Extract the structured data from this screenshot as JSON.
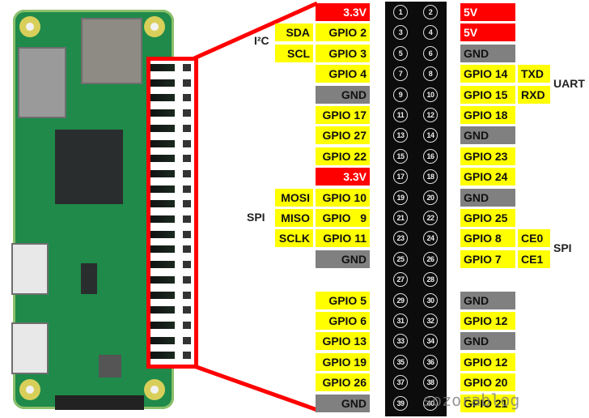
{
  "colors": {
    "power": "#ff0000",
    "gpio": "#ffff00",
    "ground": "#808080",
    "header": "#0c0c0c",
    "highlight": "#ff0000"
  },
  "rows": [
    {
      "l": "3.3V",
      "lt": "r",
      "lf": "",
      "p1": "1",
      "p2": "2",
      "r": "5V",
      "rt": "r",
      "rf": ""
    },
    {
      "l": "GPIO 2",
      "lt": "y",
      "lf": "SDA",
      "p1": "3",
      "p2": "4",
      "r": "5V",
      "rt": "r",
      "rf": ""
    },
    {
      "l": "GPIO 3",
      "lt": "y",
      "lf": "SCL",
      "p1": "5",
      "p2": "6",
      "r": "GND",
      "rt": "g",
      "rf": ""
    },
    {
      "l": "GPIO 4",
      "lt": "y",
      "lf": "",
      "p1": "7",
      "p2": "8",
      "r": "GPIO 14",
      "rt": "y",
      "rf": "TXD"
    },
    {
      "l": "GND",
      "lt": "g",
      "lf": "",
      "p1": "9",
      "p2": "10",
      "r": "GPIO 15",
      "rt": "y",
      "rf": "RXD"
    },
    {
      "l": "GPIO 17",
      "lt": "y",
      "lf": "",
      "p1": "11",
      "p2": "12",
      "r": "GPIO 18",
      "rt": "y",
      "rf": ""
    },
    {
      "l": "GPIO 27",
      "lt": "y",
      "lf": "",
      "p1": "13",
      "p2": "14",
      "r": "GND",
      "rt": "g",
      "rf": ""
    },
    {
      "l": "GPIO 22",
      "lt": "y",
      "lf": "",
      "p1": "15",
      "p2": "16",
      "r": "GPIO 23",
      "rt": "y",
      "rf": ""
    },
    {
      "l": "3.3V",
      "lt": "r",
      "lf": "",
      "p1": "17",
      "p2": "18",
      "r": "GPIO 24",
      "rt": "y",
      "rf": ""
    },
    {
      "l": "GPIO 10",
      "lt": "y",
      "lf": "MOSI",
      "p1": "19",
      "p2": "20",
      "r": "GND",
      "rt": "g",
      "rf": ""
    },
    {
      "l": "GPIO   9",
      "lt": "y",
      "lf": "MISO",
      "p1": "21",
      "p2": "22",
      "r": "GPIO 25",
      "rt": "y",
      "rf": ""
    },
    {
      "l": "GPIO 11",
      "lt": "y",
      "lf": "SCLK",
      "p1": "23",
      "p2": "24",
      "r": "GPIO 8",
      "rt": "y",
      "rf": "CE0"
    },
    {
      "l": "GND",
      "lt": "g",
      "lf": "",
      "p1": "25",
      "p2": "26",
      "r": "GPIO 7",
      "rt": "y",
      "rf": "CE1"
    },
    {
      "l": "",
      "lt": "",
      "lf": "",
      "p1": "27",
      "p2": "28",
      "r": "",
      "rt": "",
      "rf": ""
    },
    {
      "l": "GPIO 5",
      "lt": "y",
      "lf": "",
      "p1": "29",
      "p2": "30",
      "r": "GND",
      "rt": "g",
      "rf": ""
    },
    {
      "l": "GPIO 6",
      "lt": "y",
      "lf": "",
      "p1": "31",
      "p2": "32",
      "r": "GPIO 12",
      "rt": "y",
      "rf": ""
    },
    {
      "l": "GPIO 13",
      "lt": "y",
      "lf": "",
      "p1": "33",
      "p2": "34",
      "r": "GND",
      "rt": "g",
      "rf": ""
    },
    {
      "l": "GPIO 19",
      "lt": "y",
      "lf": "",
      "p1": "35",
      "p2": "36",
      "r": "GPIO 12",
      "rt": "y",
      "rf": ""
    },
    {
      "l": "GPIO 26",
      "lt": "y",
      "lf": "",
      "p1": "37",
      "p2": "38",
      "r": "GPIO 20",
      "rt": "y",
      "rf": ""
    },
    {
      "l": "GND",
      "lt": "g",
      "lf": "",
      "p1": "39",
      "p2": "40",
      "r": "GPIO 21",
      "rt": "y",
      "rf": ""
    }
  ],
  "groups": {
    "i2c": "I²C",
    "spi_left": "SPI",
    "uart": "UART",
    "spi_right": "SPI"
  },
  "watermark": "sozorablog"
}
